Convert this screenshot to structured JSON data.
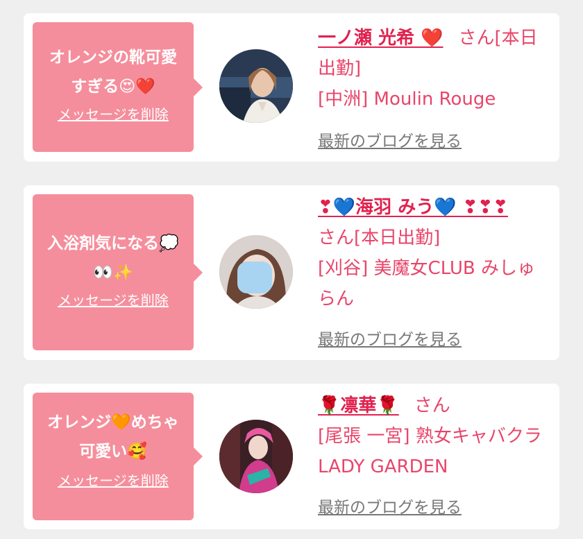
{
  "items": [
    {
      "message_line1": "オレンジの靴可愛",
      "message_line2": "すぎる😍❤️",
      "delete_label": "メッセージを削除",
      "name": "一ノ瀬 光希 ❤️",
      "san": "さん[本日出勤]",
      "shop": "[中洲] Moulin Rouge",
      "blog_label": "最新のブログを見る"
    },
    {
      "message_line1": "入浴剤気になる💭",
      "message_line2": "👀✨",
      "delete_label": "メッセージを削除",
      "name": "❣💙海羽 みう💙 ❣❣❣",
      "san": "さん[本日出勤]",
      "shop": "[刈谷] 美魔女CLUB みしゅらん",
      "blog_label": "最新のブログを見る"
    },
    {
      "message_line1": "オレンジ🧡めちゃ",
      "message_line2": "可愛い🥰",
      "delete_label": "メッセージを削除",
      "name": "🌹凛華🌹",
      "san": "さん",
      "shop": "[尾張 一宮] 熟女キャバクラ LADY GARDEN",
      "blog_label": "最新のブログを見る"
    }
  ]
}
